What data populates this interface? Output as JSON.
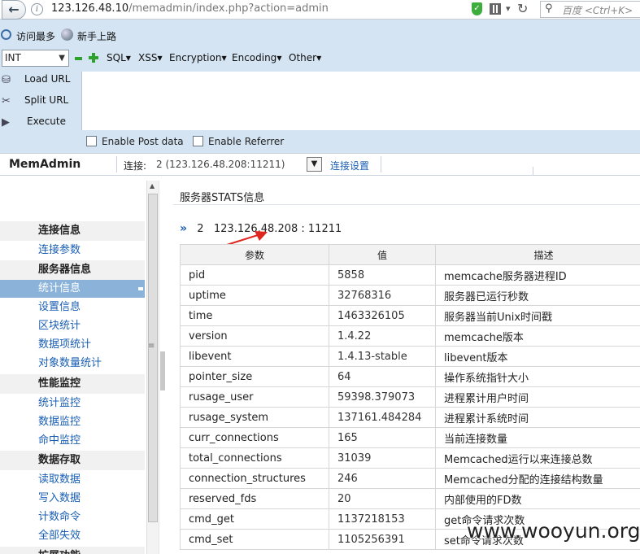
{
  "browser": {
    "url_host": "123.126.48.10",
    "url_path": "/memadmin/index.php?action=admin",
    "search_placeholder": "百度 <Ctrl+K>"
  },
  "bookmarks": [
    {
      "label": "访问最多",
      "icon": "search-icon"
    },
    {
      "label": "新手上路",
      "icon": "globe-icon"
    }
  ],
  "hackbar": {
    "select_value": "INT",
    "menus": [
      "SQL",
      "XSS",
      "Encryption",
      "Encoding",
      "Other"
    ],
    "buttons": {
      "load": "Load URL",
      "split": "Split URL",
      "execute": "Execute"
    },
    "checkboxes": {
      "post": "Enable Post data",
      "referrer": "Enable Referrer"
    }
  },
  "header": {
    "brand": "MemAdmin",
    "conn_label": "连接:",
    "conn_value": "2 (123.126.48.208:11211)",
    "conn_settings": "连接设置"
  },
  "sidebar": {
    "groups": [
      {
        "title": "连接信息",
        "items": [
          "连接参数"
        ]
      },
      {
        "title": "服务器信息",
        "items": [
          "统计信息",
          "设置信息",
          "区块统计",
          "数据项统计",
          "对象数量统计"
        ]
      },
      {
        "title": "性能监控",
        "items": [
          "统计监控",
          "数据监控",
          "命中监控"
        ]
      },
      {
        "title": "数据存取",
        "items": [
          "读取数据",
          "写入数据",
          "计数命令",
          "全部失效"
        ]
      },
      {
        "title": "扩展功能",
        "items": []
      }
    ],
    "active_item": "统计信息"
  },
  "main": {
    "title": "服务器STATS信息",
    "server_index": "2",
    "server_addr": "123.126.48.208 : 11211",
    "columns": [
      "参数",
      "值",
      "描述"
    ],
    "rows": [
      [
        "pid",
        "5858",
        "memcache服务器进程ID"
      ],
      [
        "uptime",
        "32768316",
        "服务器已运行秒数"
      ],
      [
        "time",
        "1463326105",
        "服务器当前Unix时间戳"
      ],
      [
        "version",
        "1.4.22",
        "memcache版本"
      ],
      [
        "libevent",
        "1.4.13-stable",
        "libevent版本"
      ],
      [
        "pointer_size",
        "64",
        "操作系统指针大小"
      ],
      [
        "rusage_user",
        "59398.379073",
        "进程累计用户时间"
      ],
      [
        "rusage_system",
        "137161.484284",
        "进程累计系统时间"
      ],
      [
        "curr_connections",
        "165",
        "当前连接数量"
      ],
      [
        "total_connections",
        "31039",
        "Memcached运行以来连接总数"
      ],
      [
        "connection_structures",
        "246",
        "Memcached分配的连接结构数量"
      ],
      [
        "reserved_fds",
        "20",
        "内部使用的FD数"
      ],
      [
        "cmd_get",
        "1137218153",
        "get命令请求次数"
      ],
      [
        "cmd_set",
        "1105256391",
        "set命令请求次数"
      ]
    ]
  },
  "watermark": "www.wooyun.org"
}
